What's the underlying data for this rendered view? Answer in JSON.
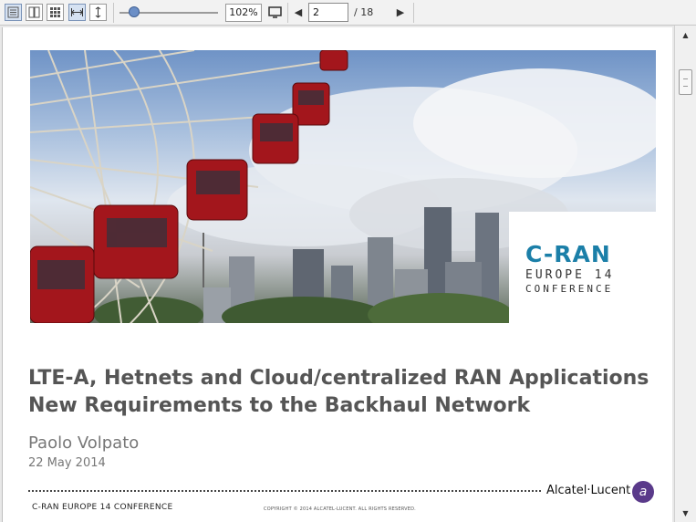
{
  "toolbar": {
    "icons": [
      "single-page-icon",
      "two-page-icon",
      "thumbnail-grid-icon",
      "fit-width-icon",
      "fit-height-icon",
      "fullscreen-icon",
      "prev-page-icon",
      "next-page-icon"
    ],
    "zoom_value": "102%",
    "page_current": "2",
    "page_total": "/ 18",
    "zoom_slider_level": 0.12
  },
  "slide": {
    "logo": {
      "line1": "C-RAN",
      "line2": "EUROPE 14",
      "line3": "CONFERENCE"
    },
    "title_line1": "LTE-A, Hetnets and Cloud/centralized RAN Applications",
    "title_line2": "New Requirements to the Backhaul Network",
    "author": "Paolo Volpato",
    "date": "22 May 2014",
    "brand": "Alcatel·Lucent",
    "footer_left": "C-RAN EUROPE 14 CONFERENCE",
    "footer_center": "COPYRIGHT © 2014 ALCATEL-LUCENT.   ALL RIGHTS RESERVED."
  },
  "colors": {
    "logo_accent": "#1b7fa8",
    "title_text": "#555555",
    "brand_purple": "#5a3a8a"
  }
}
